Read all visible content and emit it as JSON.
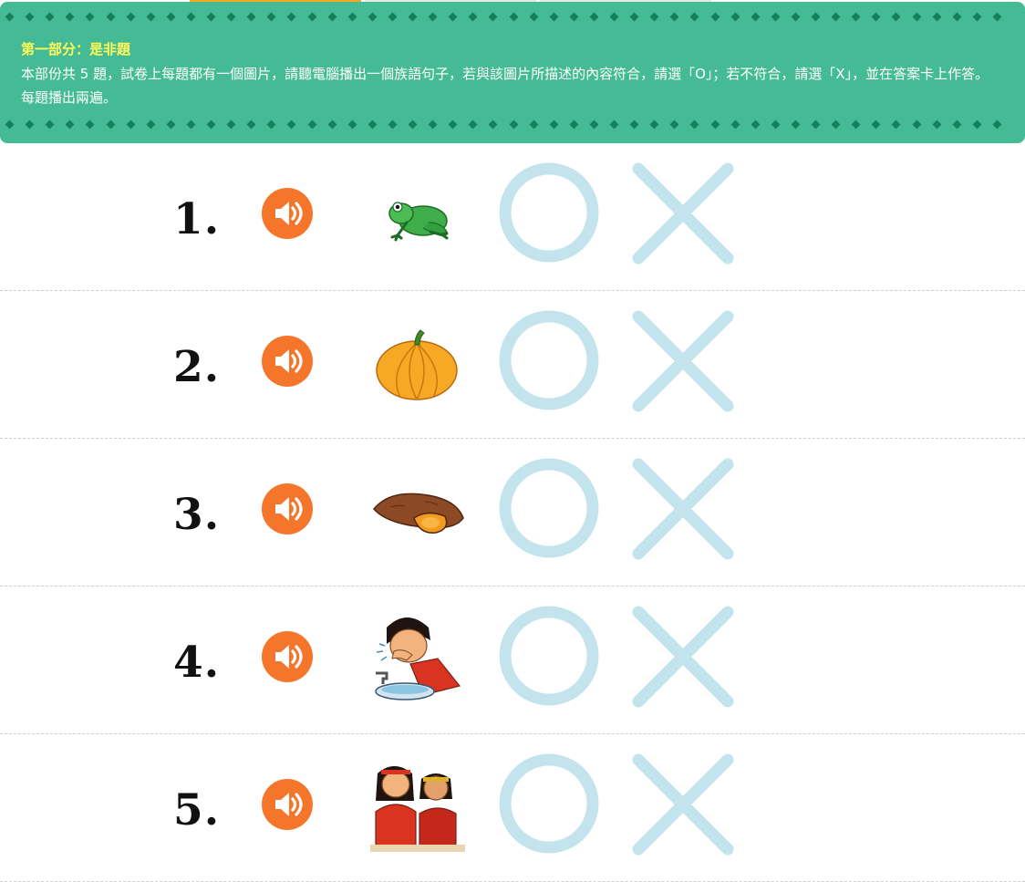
{
  "section": {
    "title": "第一部分：是非題",
    "description": "本部份共 5 題，試卷上每題都有一個圖片，請聽電腦播出一個族語句子，若與該圖片所描述的內容符合，請選「O」；若不符合，請選「X」，並在答案卡上作答。每題播出兩遍。"
  },
  "colors": {
    "banner": "#45bb95",
    "banner_title": "#fff95a",
    "diamond": "#14805c",
    "speaker": "#f5752a",
    "answer_mark": "#c4e4ed"
  },
  "questions": [
    {
      "number": "1.",
      "picture": "frog-image",
      "audio_icon": "speaker-icon"
    },
    {
      "number": "2.",
      "picture": "pumpkin-image",
      "audio_icon": "speaker-icon"
    },
    {
      "number": "3.",
      "picture": "sweet-potato-image",
      "audio_icon": "speaker-icon"
    },
    {
      "number": "4.",
      "picture": "face-washing-image",
      "audio_icon": "speaker-icon"
    },
    {
      "number": "5.",
      "picture": "two-people-image",
      "audio_icon": "speaker-icon"
    }
  ],
  "answer_options": {
    "true_mark": "circle-o-icon",
    "false_mark": "cross-x-icon"
  }
}
